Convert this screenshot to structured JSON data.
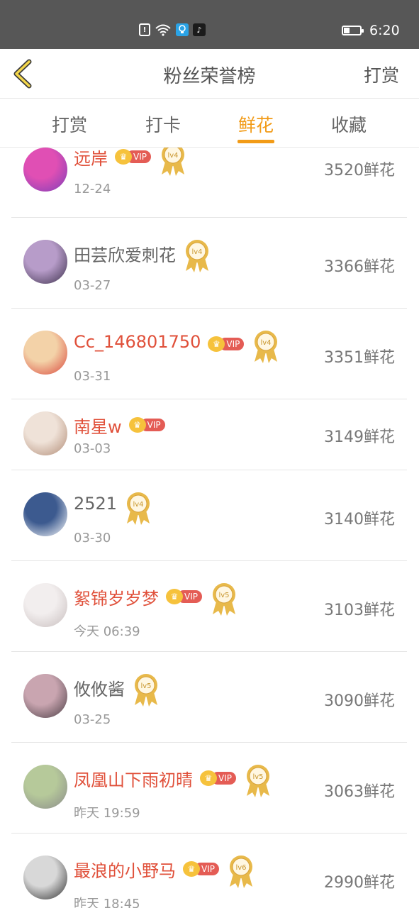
{
  "status_bar": {
    "time": "6:20",
    "battery_level": 0.35,
    "icons": [
      "alert-icon",
      "wifi-icon",
      "lightbulb-app-icon",
      "tiktok-icon"
    ]
  },
  "header": {
    "title": "粉丝荣誉榜",
    "right_action": "打赏"
  },
  "tabs": [
    {
      "label": "打赏",
      "active": false
    },
    {
      "label": "打卡",
      "active": false
    },
    {
      "label": "鲜花",
      "active": true
    },
    {
      "label": "收藏",
      "active": false
    }
  ],
  "colors": {
    "accent": "#f29b17",
    "vip_name": "#e0503a",
    "plain_name": "#666666",
    "vip_tag": "#e45c55",
    "medal": "#e8b94a"
  },
  "vip_label": "VIP",
  "list": [
    {
      "name": "远岸",
      "vip": true,
      "level": "lv4",
      "date": "12-24",
      "count": "3520鲜花",
      "avatar_colors": [
        "#e04fb4",
        "#7b3fb8"
      ]
    },
    {
      "name": "田芸欣爱刺花",
      "vip": false,
      "level": "lv4",
      "date": "03-27",
      "count": "3366鲜花",
      "avatar_colors": [
        "#b79cc9",
        "#3b2f4a"
      ]
    },
    {
      "name": "Cc_146801750",
      "vip": true,
      "level": "lv4",
      "date": "03-31",
      "count": "3351鲜花",
      "avatar_colors": [
        "#f3d2a8",
        "#d9463b"
      ]
    },
    {
      "name": "南星w",
      "vip": true,
      "level": "",
      "date": "03-03",
      "count": "3149鲜花",
      "avatar_colors": [
        "#efe2d8",
        "#b08a74"
      ]
    },
    {
      "name": "2521",
      "vip": false,
      "level": "lv4",
      "date": "03-30",
      "count": "3140鲜花",
      "avatar_colors": [
        "#3c5a8f",
        "#ffffff"
      ]
    },
    {
      "name": "絮锦岁岁梦",
      "vip": true,
      "level": "lv5",
      "date": "今天 06:39",
      "count": "3103鲜花",
      "avatar_colors": [
        "#f2eeee",
        "#c7bdbd"
      ]
    },
    {
      "name": "攸攸酱",
      "vip": false,
      "level": "lv5",
      "date": "03-25",
      "count": "3090鲜花",
      "avatar_colors": [
        "#c9a5b0",
        "#4a3d44"
      ]
    },
    {
      "name": "凤凰山下雨初晴",
      "vip": true,
      "level": "lv5",
      "date": "昨天 19:59",
      "count": "3063鲜花",
      "avatar_colors": [
        "#b6c99a",
        "#8a8a8a"
      ]
    },
    {
      "name": "最浪的小野马",
      "vip": true,
      "level": "lv6",
      "date": "昨天 18:45",
      "count": "2990鲜花",
      "avatar_colors": [
        "#d8d8d8",
        "#2f2f2f"
      ]
    }
  ]
}
